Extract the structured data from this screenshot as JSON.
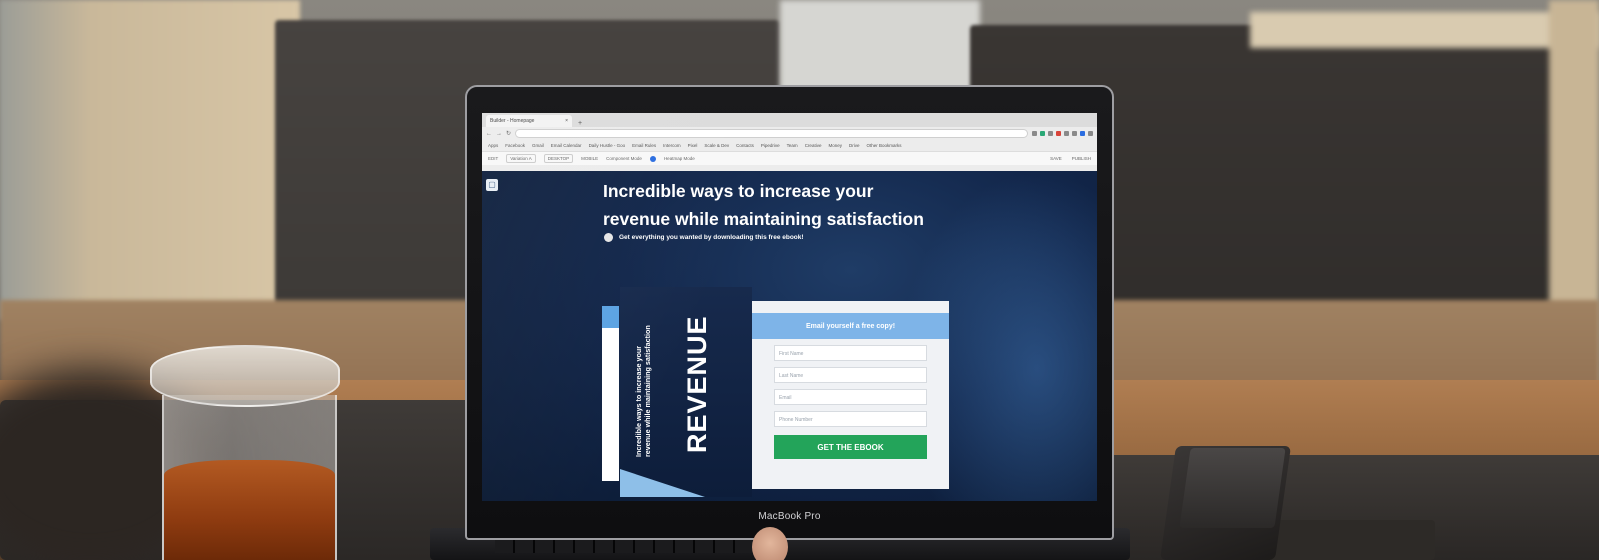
{
  "browser": {
    "tab_title": "Builder - Homepage",
    "new_tab": "+",
    "bookmarks": [
      "Apps",
      "Facebook",
      "Gmail",
      "Email Calendar",
      "Daily Hustle - Goo",
      "Email Rules",
      "Intercom",
      "Pixel",
      "Scale & Dev",
      "Contacts",
      "Pipedrive",
      "Team",
      "Creative",
      "Money",
      "Drive",
      "Other Bookmarks"
    ],
    "editor": {
      "label_edit": "EDIT",
      "variation": "Variation A",
      "desktop": "DESKTOP",
      "mobile": "MOBILE",
      "component_mode": "Component Mode",
      "heatmap_mode": "Heatmap Mode",
      "save": "SAVE",
      "publish": "PUBLISH"
    }
  },
  "landing": {
    "headline_line1": "Incredible ways to increase your",
    "headline_line2": "revenue while maintaining satisfaction",
    "subtext": "Get everything you wanted by downloading this free ebook!",
    "book_title": "REVENUE",
    "book_sub_line1": "Incredible ways to increase your",
    "book_sub_line2": "revenue while maintaining satisfaction",
    "form_heading": "Email yourself a free copy!",
    "fields": [
      "First Name",
      "Last Name",
      "Email",
      "Phone Number"
    ],
    "cta": "GET THE EBOOK"
  },
  "laptop": {
    "brand": "MacBook Pro"
  }
}
